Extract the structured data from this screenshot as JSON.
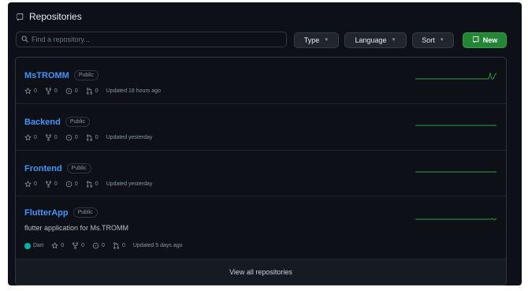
{
  "header": {
    "title": "Repositories"
  },
  "search": {
    "placeholder": "Find a repository..."
  },
  "filters": {
    "type_label": "Type",
    "language_label": "Language",
    "sort_label": "Sort",
    "new_label": "New"
  },
  "repos": [
    {
      "name": "MsTROMM",
      "visibility": "Public",
      "description": "",
      "language": "",
      "stars": "0",
      "forks": "0",
      "issues": "0",
      "pulls": "0",
      "updated": "Updated 18 hours ago"
    },
    {
      "name": "Backend",
      "visibility": "Public",
      "description": "",
      "language": "",
      "stars": "0",
      "forks": "0",
      "issues": "0",
      "pulls": "0",
      "updated": "Updated yesterday"
    },
    {
      "name": "Frontend",
      "visibility": "Public",
      "description": "",
      "language": "",
      "stars": "0",
      "forks": "0",
      "issues": "0",
      "pulls": "0",
      "updated": "Updated yesterday"
    },
    {
      "name": "FlutterApp",
      "visibility": "Public",
      "description": "flutter application for Ms.TROMM",
      "language": "Dart",
      "stars": "0",
      "forks": "0",
      "issues": "0",
      "pulls": "0",
      "updated": "Updated 5 days ago"
    }
  ],
  "footer": {
    "view_all_label": "View all repositories"
  },
  "colors": {
    "accent_link": "#4493f8",
    "new_button": "#238636",
    "dart_language": "#00b4ab",
    "sparkline": "#2ea043"
  }
}
